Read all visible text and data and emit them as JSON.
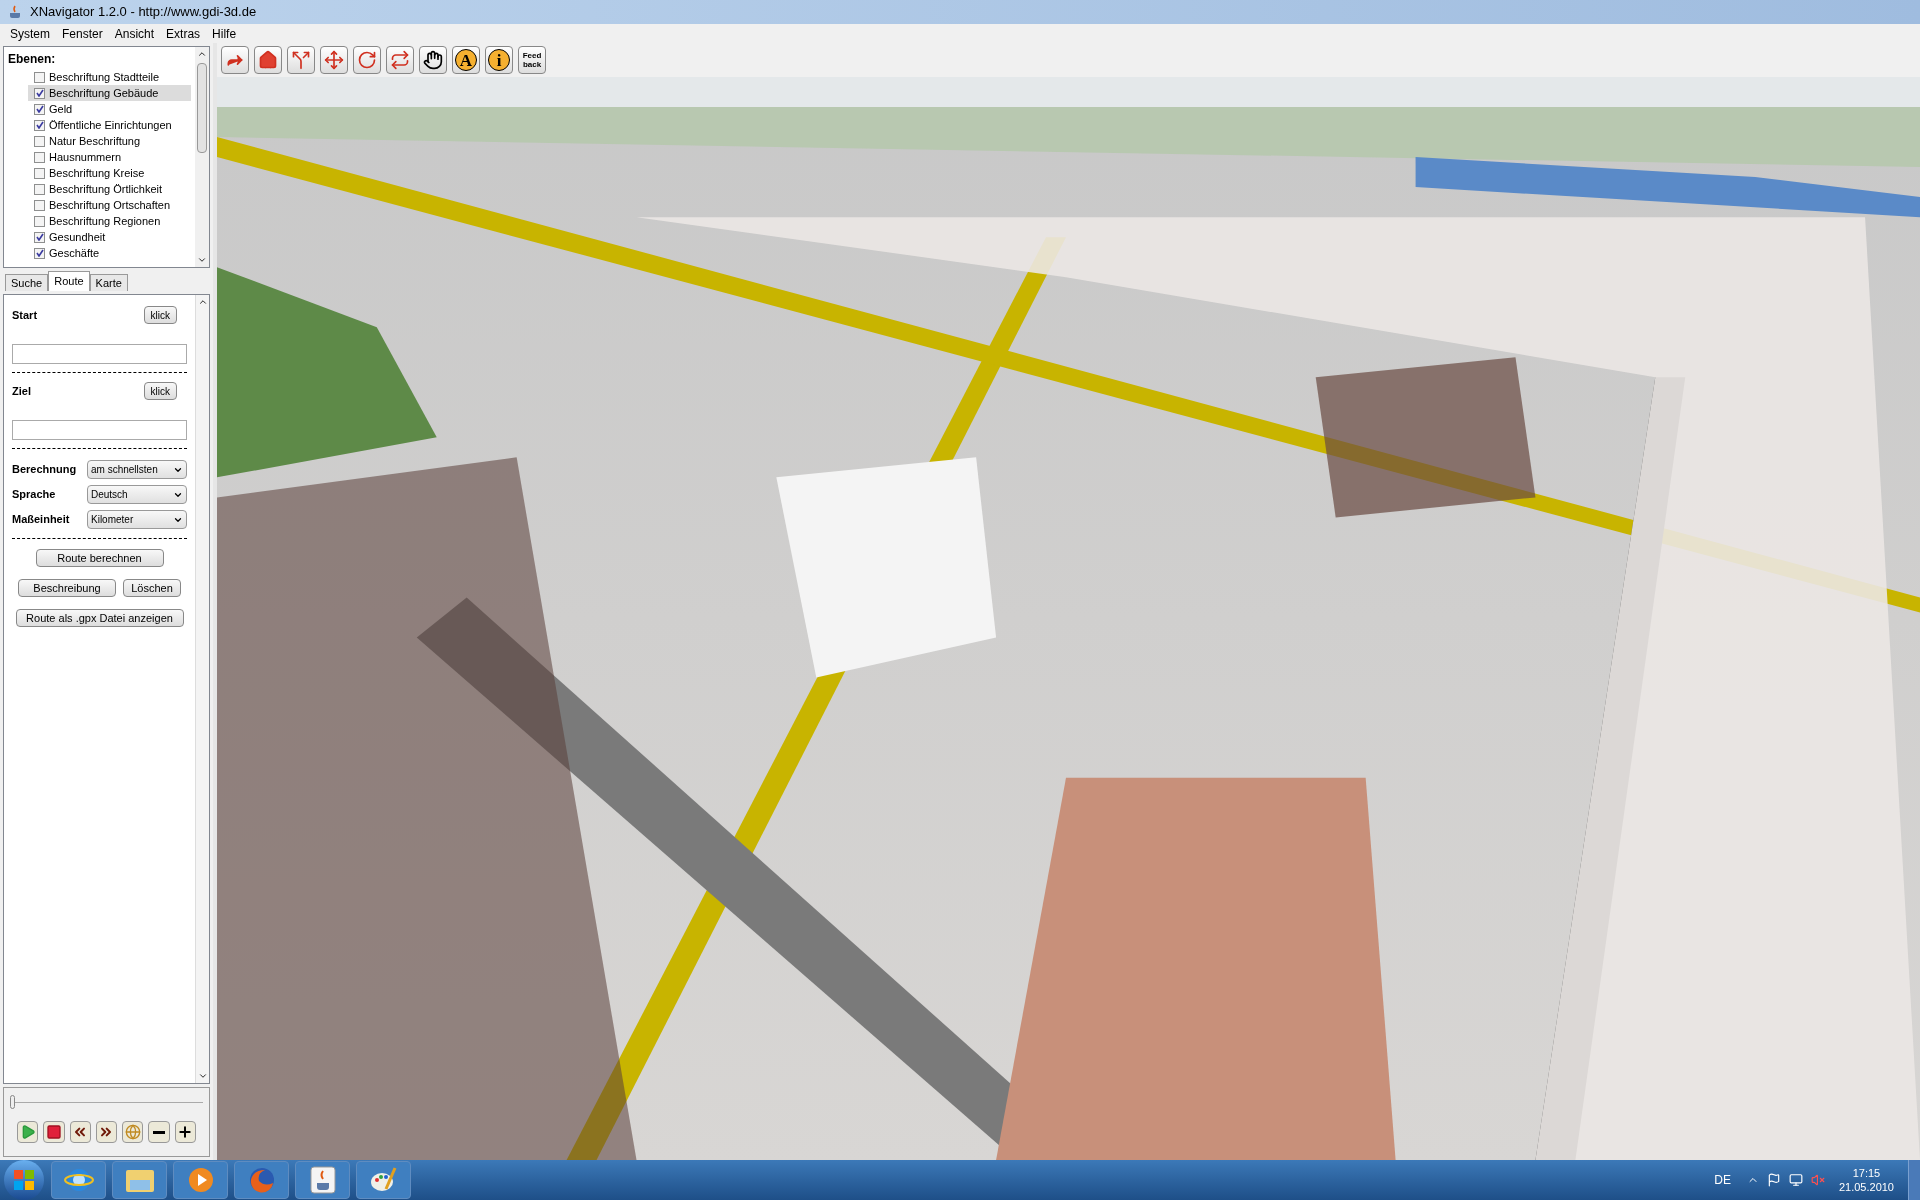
{
  "window": {
    "title": "XNavigator 1.2.0 - http://www.gdi-3d.de"
  },
  "menu": [
    "System",
    "Fenster",
    "Ansicht",
    "Extras",
    "Hilfe"
  ],
  "layers": {
    "title": "Ebenen:",
    "items": [
      {
        "label": "Beschriftung Stadtteile",
        "checked": false,
        "selected": false
      },
      {
        "label": "Beschriftung Gebäude",
        "checked": true,
        "selected": true
      },
      {
        "label": "Geld",
        "checked": true,
        "selected": false
      },
      {
        "label": "Öffentliche Einrichtungen",
        "checked": true,
        "selected": false
      },
      {
        "label": "Natur Beschriftung",
        "checked": false,
        "selected": false
      },
      {
        "label": "Hausnummern",
        "checked": false,
        "selected": false
      },
      {
        "label": "Beschriftung Kreise",
        "checked": false,
        "selected": false
      },
      {
        "label": "Beschriftung Örtlichkeit",
        "checked": false,
        "selected": false
      },
      {
        "label": "Beschriftung Ortschaften",
        "checked": false,
        "selected": false
      },
      {
        "label": "Beschriftung Regionen",
        "checked": false,
        "selected": false
      },
      {
        "label": "Gesundheit",
        "checked": true,
        "selected": false
      },
      {
        "label": "Geschäfte",
        "checked": true,
        "selected": false
      }
    ]
  },
  "tabs": [
    {
      "label": "Suche",
      "selected": false
    },
    {
      "label": "Route",
      "selected": true
    },
    {
      "label": "Karte",
      "selected": false
    }
  ],
  "route": {
    "start": {
      "label": "Start",
      "button": "klick"
    },
    "ziel": {
      "label": "Ziel",
      "button": "klick"
    },
    "selects": [
      {
        "label": "Berechnung",
        "value": "am schnellsten"
      },
      {
        "label": "Sprache",
        "value": "Deutsch"
      },
      {
        "label": "Maßeinheit",
        "value": "Kilometer"
      }
    ],
    "calculate": "Route berechnen",
    "describe": "Beschreibung",
    "delete": "Löschen",
    "gpx": "Route als .gpx Datei anzeigen"
  },
  "timeline": {
    "level": 0.0
  },
  "playback": [
    {
      "kind": "play"
    },
    {
      "kind": "stop"
    },
    {
      "kind": "rewind"
    },
    {
      "kind": "forward"
    },
    {
      "kind": "globe"
    },
    {
      "kind": "minus"
    },
    {
      "kind": "plus"
    }
  ],
  "toolbar": [
    {
      "kind": "jump"
    },
    {
      "kind": "house"
    },
    {
      "kind": "split"
    },
    {
      "kind": "move"
    },
    {
      "kind": "rotate"
    },
    {
      "kind": "swap"
    },
    {
      "kind": "hand"
    },
    {
      "kind": "letter",
      "label": "A"
    },
    {
      "kind": "letter",
      "label": "i"
    },
    {
      "kind": "text",
      "label": "Feed back"
    }
  ],
  "map": {
    "kind": "picture"
  },
  "taskbar": {
    "apps": [
      {
        "kind": "browser-e"
      },
      {
        "kind": "folder"
      },
      {
        "kind": "media"
      },
      {
        "kind": "browser-fox"
      },
      {
        "kind": "java"
      },
      {
        "kind": "paint"
      }
    ],
    "language": "DE",
    "time": "17:15",
    "date": "21.05.2010"
  }
}
